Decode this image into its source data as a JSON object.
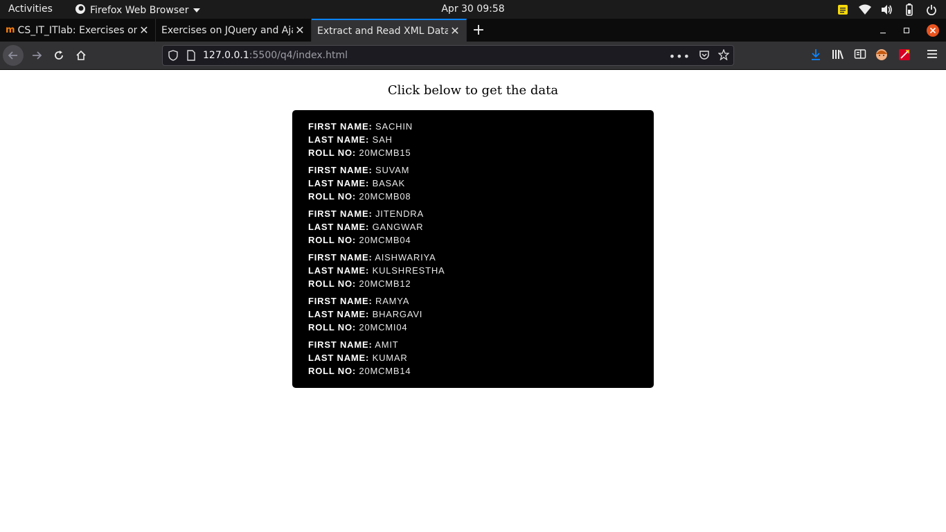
{
  "system": {
    "activities": "Activities",
    "app_name": "Firefox Web Browser",
    "clock": "Apr 30  09:58"
  },
  "tabs": [
    {
      "title": "CS_IT_ITlab: Exercises on",
      "active": false
    },
    {
      "title": "Exercises on JQuery and Aja",
      "active": false
    },
    {
      "title": "Extract and Read XML Data",
      "active": true
    }
  ],
  "address": {
    "host": "127.0.0.1",
    "rest": ":5500/q4/index.html"
  },
  "page": {
    "heading": "Click below to get the data",
    "labels": {
      "first": "FIRST NAME:",
      "last": "LAST NAME:",
      "roll": "ROLL NO:"
    },
    "records": [
      {
        "first": "SACHIN",
        "last": "SAH",
        "roll": "20MCMB15"
      },
      {
        "first": "SUVAM",
        "last": "BASAK",
        "roll": "20MCMB08"
      },
      {
        "first": "JITENDRA",
        "last": "GANGWAR",
        "roll": "20MCMB04"
      },
      {
        "first": "AISHWARIYA",
        "last": "KULSHRESTHA",
        "roll": "20MCMB12"
      },
      {
        "first": "RAMYA",
        "last": "BHARGAVI",
        "roll": "20MCMI04"
      },
      {
        "first": "AMIT",
        "last": "KUMAR",
        "roll": "20MCMB14"
      }
    ]
  },
  "colors": {
    "accent": "#0a84ff",
    "close_button": "#e95420",
    "download_arrow": "#0a84ff"
  }
}
